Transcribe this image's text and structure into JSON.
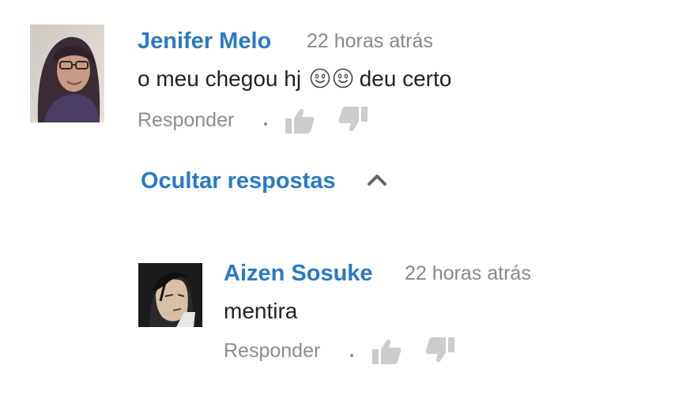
{
  "comments": [
    {
      "author": "Jenifer Melo",
      "timestamp": "22 horas atrás",
      "text": "o meu chegou hj",
      "text_suffix": "deu certo",
      "emojis": [
        "smiley-icon",
        "smiley-icon"
      ],
      "reply_label": "Responder",
      "avatar": "avatar-photo-woman-glasses"
    },
    {
      "author": "Aizen Sosuke",
      "timestamp": "22 horas atrás",
      "text": "mentira",
      "reply_label": "Responder",
      "avatar": "avatar-anime-character"
    }
  ],
  "replies_toggle": {
    "label": "Ocultar respostas",
    "icon": "chevron-up-icon"
  },
  "colors": {
    "author": "#2a7ac2",
    "toggle": "#2a7ac2",
    "timestamp": "#888888",
    "text": "#222222",
    "reply": "#8c8c8c",
    "thumb": "#cccccc"
  }
}
